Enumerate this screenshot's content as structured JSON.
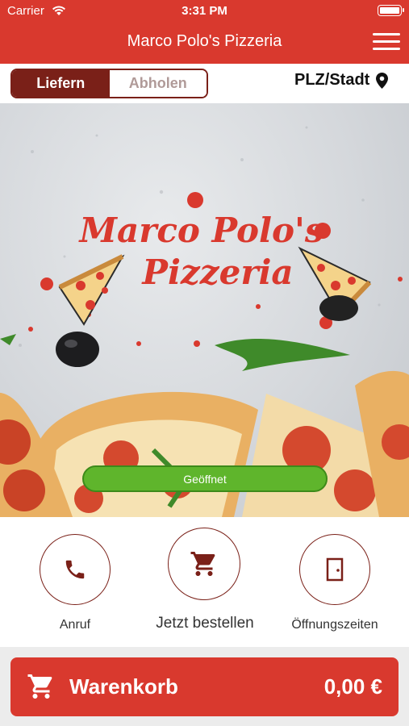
{
  "status_bar": {
    "carrier": "Carrier",
    "time": "3:31 PM"
  },
  "header": {
    "title": "Marco Polo's Pizzeria"
  },
  "order_mode": {
    "options": [
      "Liefern",
      "Abholen"
    ],
    "selected": "Liefern"
  },
  "location": {
    "label": "PLZ/Stadt"
  },
  "hero": {
    "logo_line1": "Marco Polo's",
    "logo_line2": "Pizzeria",
    "status_button": "Geöffnet"
  },
  "actions": [
    {
      "label": "Anruf",
      "icon": "phone-icon"
    },
    {
      "label": "Jetzt bestellen",
      "icon": "cart-icon"
    },
    {
      "label": "Öffnungszeiten",
      "icon": "door-icon"
    }
  ],
  "cart": {
    "label": "Warenkorb",
    "total": "0,00 €"
  },
  "colors": {
    "brand_red": "#d9392e",
    "dark_red": "#7a2018",
    "open_green": "#5fb52c"
  }
}
